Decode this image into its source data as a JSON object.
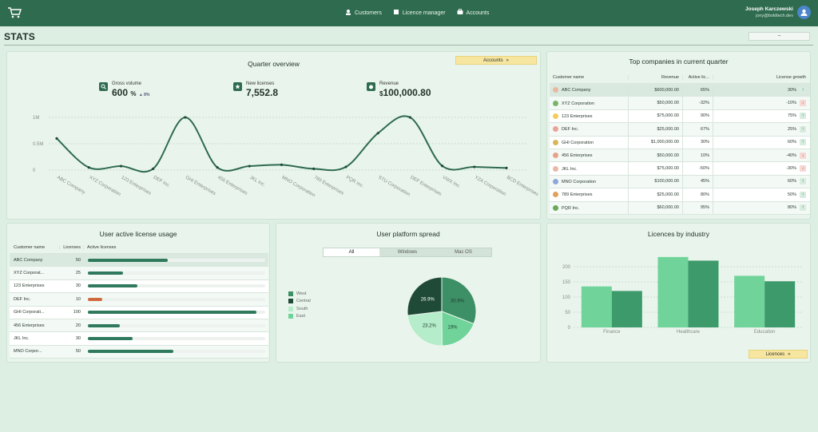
{
  "nav": {
    "customers": "Customers",
    "licence_manager": "Licence manager",
    "accounts": "Accounts"
  },
  "user": {
    "name": "Joseph Karczewski",
    "email": "jony@boldtech.dev"
  },
  "page": {
    "title": "STATS",
    "date_value": "–"
  },
  "quarter": {
    "title": "Quarter overview",
    "accounts_btn": "Accounts",
    "gross_label": "Gross volume",
    "gross_value": "600",
    "gross_unit": "%",
    "gross_change": "▲ 8%",
    "new_label": "New licenses",
    "new_value": "7,552.8",
    "revenue_label": "Revenue",
    "revenue_symbol": "$",
    "revenue_value": "100,000.80"
  },
  "chart_data": [
    {
      "type": "line",
      "title": "Quarter overview",
      "categories": [
        "ABC Company",
        "XYZ Corporation",
        "123 Enterprises",
        "DEF Inc.",
        "GHI Enterprises",
        "456 Enterprises",
        "JKL Inc.",
        "MNO Corporation",
        "789 Enterprises",
        "PQR Inc.",
        "STU Corporation",
        "DEF Enterprises",
        "VWX Inc.",
        "YZA Corporation",
        "BCD Enterprises"
      ],
      "values": [
        600000,
        50000,
        75000,
        25000,
        1000000,
        50000,
        75000,
        100000,
        25000,
        60000,
        700000,
        1000000,
        80000,
        60000,
        40000
      ],
      "yticks": [
        "0",
        "0.5M",
        "1M"
      ],
      "ylim": [
        0,
        1100000
      ],
      "grid": true
    },
    {
      "type": "pie",
      "title": "User platform spread",
      "labels": [
        "West",
        "Central",
        "South",
        "East"
      ],
      "values": [
        30.9,
        26.9,
        23.2,
        19
      ],
      "value_labels": [
        "30.9%",
        "26.9%",
        "23.2%",
        "19%"
      ]
    },
    {
      "type": "bar",
      "title": "Licences by industry",
      "categories": [
        "Finance",
        "Healthcare",
        "Education"
      ],
      "series": [
        {
          "values": [
            135,
            232,
            170
          ]
        },
        {
          "values": [
            120,
            220,
            152
          ]
        }
      ],
      "yticks": [
        "0",
        "50",
        "100",
        "150",
        "200"
      ],
      "ylim": [
        0,
        250
      ]
    }
  ],
  "top": {
    "title": "Top companies in current quarter",
    "headers": [
      "Customer name",
      "Revenue",
      "Active lic...",
      "License growth"
    ],
    "rows": [
      {
        "name": "ABC Company",
        "revenue": "$600,000.00",
        "active": "65%",
        "growth": "30%",
        "up": true,
        "logo": "#e8b9a0"
      },
      {
        "name": "XYZ Corporation",
        "revenue": "$50,000.00",
        "active": "-32%",
        "growth": "-10%",
        "up": false,
        "logo": "#7bb36b"
      },
      {
        "name": "123 Enterprises",
        "revenue": "$75,000.00",
        "active": "90%",
        "growth": "75%",
        "up": true,
        "logo": "#f1cd5b"
      },
      {
        "name": "DEF Inc.",
        "revenue": "$25,000.00",
        "active": "67%",
        "growth": "25%",
        "up": true,
        "logo": "#e9a49a"
      },
      {
        "name": "GHI Corporation",
        "revenue": "$1,000,000.00",
        "active": "30%",
        "growth": "60%",
        "up": true,
        "logo": "#d9b55c"
      },
      {
        "name": "456 Enterprises",
        "revenue": "$50,000.00",
        "active": "10%",
        "growth": "-40%",
        "up": false,
        "logo": "#e6a38c"
      },
      {
        "name": "JKL Inc.",
        "revenue": "$75,000.00",
        "active": "-50%",
        "growth": "-30%",
        "up": false,
        "logo": "#e9b8a6"
      },
      {
        "name": "MNO Corporation",
        "revenue": "$100,000.00",
        "active": "45%",
        "growth": "60%",
        "up": true,
        "logo": "#8da8d8"
      },
      {
        "name": "789 Enterprises",
        "revenue": "$25,000.00",
        "active": "80%",
        "growth": "50%",
        "up": true,
        "logo": "#dfa15e"
      },
      {
        "name": "PQR Inc.",
        "revenue": "$60,000.00",
        "active": "95%",
        "growth": "80%",
        "up": true,
        "logo": "#6aa85c"
      }
    ]
  },
  "usage": {
    "title": "User active license usage",
    "headers": [
      "Customer name",
      "Licenses",
      "Active licenses"
    ],
    "rows": [
      {
        "name": "ABC Company",
        "licenses": "50",
        "pct": 0.45,
        "color": "#2f7a5c"
      },
      {
        "name": "XYZ Corporat...",
        "licenses": "25",
        "pct": 0.2,
        "color": "#2f7a5c"
      },
      {
        "name": "123 Enterprises",
        "licenses": "30",
        "pct": 0.28,
        "color": "#2f7a5c"
      },
      {
        "name": "DEF Inc.",
        "licenses": "10",
        "pct": 0.08,
        "color": "#d06a3e"
      },
      {
        "name": "GHI Corporati...",
        "licenses": "100",
        "pct": 0.95,
        "color": "#2f7a5c"
      },
      {
        "name": "456 Enterprises",
        "licenses": "20",
        "pct": 0.18,
        "color": "#2f7a5c"
      },
      {
        "name": "JKL Inc.",
        "licenses": "30",
        "pct": 0.25,
        "color": "#2f7a5c"
      },
      {
        "name": "MNO Corpor...",
        "licenses": "50",
        "pct": 0.48,
        "color": "#2f7a5c"
      }
    ]
  },
  "platform": {
    "title": "User platform spread",
    "tabs": [
      "All",
      "Windows",
      "Mac OS"
    ]
  },
  "industry": {
    "title": "Licences by industry",
    "licences_btn": "Licences"
  },
  "colors": {
    "header": "#2f6b4f",
    "accent": "#2f7a5c",
    "yellow": "#f6e6a0",
    "pie": [
      "#3d8f66",
      "#1f4a37",
      "#b5ecc9",
      "#6fd39a"
    ],
    "bar1": "#6fd39a",
    "bar2": "#3d9a6a"
  }
}
